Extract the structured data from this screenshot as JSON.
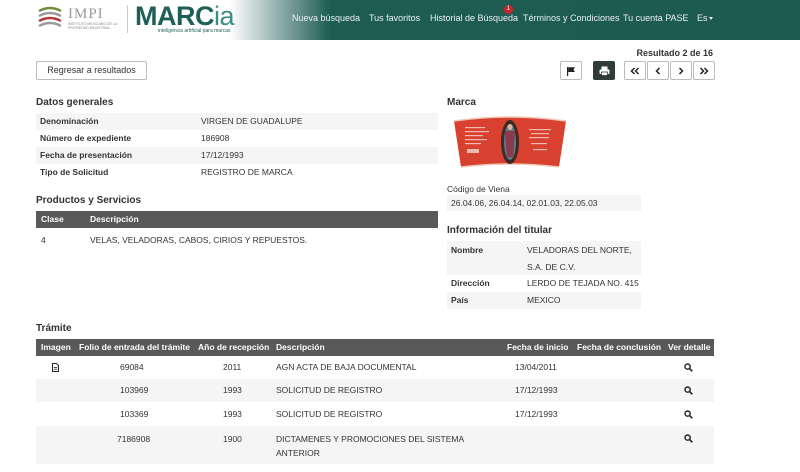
{
  "header": {
    "impi_text": "IMPI",
    "impi_subtitle": "INSTITUTO MEXICANO DE LA PROPIEDAD INDUSTRIAL",
    "marcia_main": "MARC",
    "marcia_ia": "ia",
    "marcia_tagline": "inteligencia artificial para marcas",
    "nav": [
      {
        "label": "Nueva búsqueda"
      },
      {
        "label": "Tus favoritos"
      },
      {
        "label": "Historial de Búsqueda",
        "badge": "1"
      },
      {
        "label": "Términos y Condiciones"
      },
      {
        "label": "Tu cuenta PASE"
      },
      {
        "label": "Es"
      }
    ]
  },
  "toolbar": {
    "back_label": "Regresar a resultados",
    "result_count": "Resultado 2 de 16"
  },
  "datos_generales": {
    "title": "Datos generales",
    "rows": [
      {
        "label": "Denominación",
        "value": "VIRGEN DE GUADALUPE"
      },
      {
        "label": "Número de expediente",
        "value": "186908"
      },
      {
        "label": "Fecha de presentación",
        "value": "17/12/1993"
      },
      {
        "label": "Tipo de Solicitud",
        "value": "REGISTRO DE MARCA"
      }
    ]
  },
  "productos": {
    "title": "Productos y Servicios",
    "headers": {
      "clase": "Clase",
      "descripcion": "Descripción"
    },
    "rows": [
      {
        "clase": "4",
        "descripcion": "VELAS, VELADORAS, CABOS, CIRIOS Y REPUESTOS."
      }
    ]
  },
  "marca": {
    "title": "Marca",
    "viena_label": "Código de Viena",
    "viena_value": "26.04.06, 26.04.14, 02.01.03, 22.05.03"
  },
  "titular": {
    "title": "Información del titular",
    "nombre_label": "Nombre",
    "nombre_line1": "VELADORAS DEL NORTE,",
    "nombre_line2": "S.A. DE C.V.",
    "direccion_label": "Dirección",
    "direccion_value": "LERDO DE TEJADA NO. 415",
    "pais_label": "País",
    "pais_value": "MEXICO"
  },
  "tramite": {
    "title": "Trámite",
    "headers": {
      "imagen": "Imagen",
      "folio": "Folio de entrada del trámite",
      "anio": "Año de recepción",
      "descripcion": "Descripción",
      "inicio": "Fecha de inicio",
      "conclusion": "Fecha de conclusión",
      "detalle": "Ver detalle"
    },
    "rows": [
      {
        "folio": "69084",
        "anio": "2011",
        "descripcion": "AGN ACTA DE BAJA DOCUMENTAL",
        "descripcion2": "",
        "inicio": "13/04/2011",
        "conclusion": "",
        "has_doc": true
      },
      {
        "folio": "103969",
        "anio": "1993",
        "descripcion": "SOLICITUD DE REGISTRO",
        "descripcion2": "",
        "inicio": "17/12/1993",
        "conclusion": "",
        "has_doc": false
      },
      {
        "folio": "103369",
        "anio": "1993",
        "descripcion": "SOLICITUD DE REGISTRO",
        "descripcion2": "",
        "inicio": "17/12/1993",
        "conclusion": "",
        "has_doc": false
      },
      {
        "folio": "7186908",
        "anio": "1900",
        "descripcion": "DICTAMENES Y PROMOCIONES DEL SISTEMA",
        "descripcion2": "ANTERIOR",
        "inicio": "",
        "conclusion": "",
        "has_doc": false
      }
    ]
  }
}
